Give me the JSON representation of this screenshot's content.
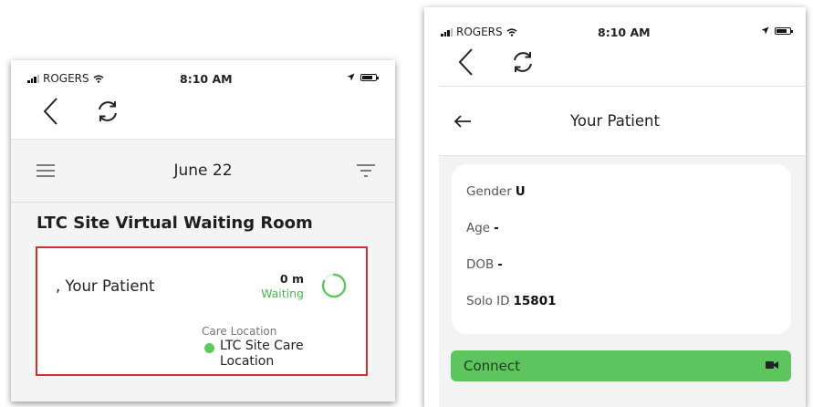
{
  "left_screen": {
    "status_bar": {
      "carrier": "ROGERS",
      "time": "8:10 AM"
    },
    "header": {
      "date": "June 22"
    },
    "room_title": "LTC Site Virtual Waiting Room",
    "patient_card": {
      "name": ", Your Patient",
      "wait_time": "0 m",
      "status": "Waiting",
      "care_location_label": "Care Location",
      "care_location": "LTC Site Care Location"
    }
  },
  "right_screen": {
    "status_bar": {
      "carrier": "ROGERS",
      "time": "8:10 AM"
    },
    "title": "Your Patient",
    "details": {
      "gender_label": "Gender",
      "gender_value": "U",
      "age_label": "Age",
      "age_value": "-",
      "dob_label": "DOB",
      "dob_value": "-",
      "solo_id_label": "Solo ID",
      "solo_id_value": "15801"
    },
    "connect_label": "Connect"
  },
  "colors": {
    "waiting_green": "#4cb84c",
    "connect_green": "#5ec55e",
    "highlight_red": "#d32f2f",
    "background_grey": "#f4f4f4"
  },
  "icons": [
    "signal-bars-icon",
    "wifi-icon",
    "location-arrow-icon",
    "battery-icon",
    "back-chevron-icon",
    "refresh-icon",
    "hamburger-menu-icon",
    "filter-icon",
    "progress-ring-icon",
    "back-arrow-icon",
    "video-camera-icon"
  ]
}
